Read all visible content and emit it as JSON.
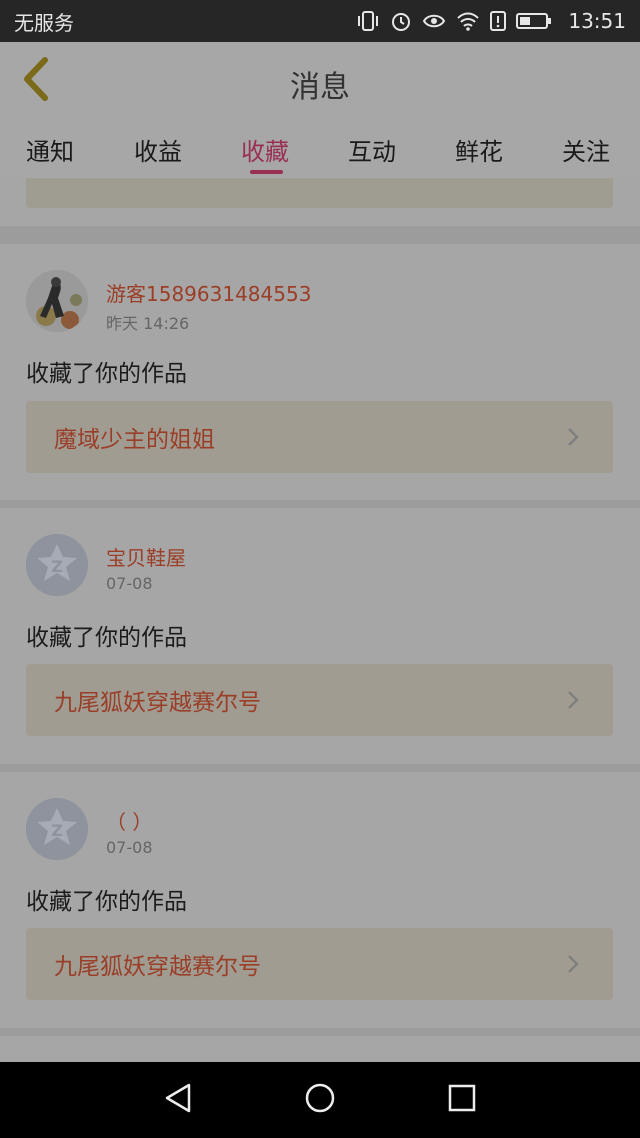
{
  "status_bar": {
    "carrier": "无服务",
    "time": "13:51",
    "icons": [
      "vibrate-icon",
      "alarm-icon",
      "eye-comfort-icon",
      "wifi-icon",
      "sim-alert-icon",
      "battery-icon"
    ]
  },
  "header": {
    "title": "消息",
    "back_icon": "chevron-left-icon"
  },
  "tabs": [
    {
      "label": "通知",
      "active": false
    },
    {
      "label": "收益",
      "active": false
    },
    {
      "label": "收藏",
      "active": true
    },
    {
      "label": "互动",
      "active": false
    },
    {
      "label": "鲜花",
      "active": false
    },
    {
      "label": "关注",
      "active": false
    }
  ],
  "messages": [
    {
      "user": "游客1589631484553",
      "time": "昨天 14:26",
      "text": "收藏了你的作品",
      "work": "魔域少主的姐姐",
      "avatar": "illustrated-photo"
    },
    {
      "user": "宝贝鞋屋",
      "time": "07-08",
      "text": "收藏了你的作品",
      "work": "九尾狐妖穿越赛尔号",
      "avatar": "default-star"
    },
    {
      "user": "（ ）",
      "time": "07-08",
      "text": "收藏了你的作品",
      "work": "九尾狐妖穿越赛尔号",
      "avatar": "default-star"
    }
  ],
  "colors": {
    "accent": "#9a2f55",
    "username": "#9b3e27",
    "overlay_bg": "#a6a6a6"
  }
}
